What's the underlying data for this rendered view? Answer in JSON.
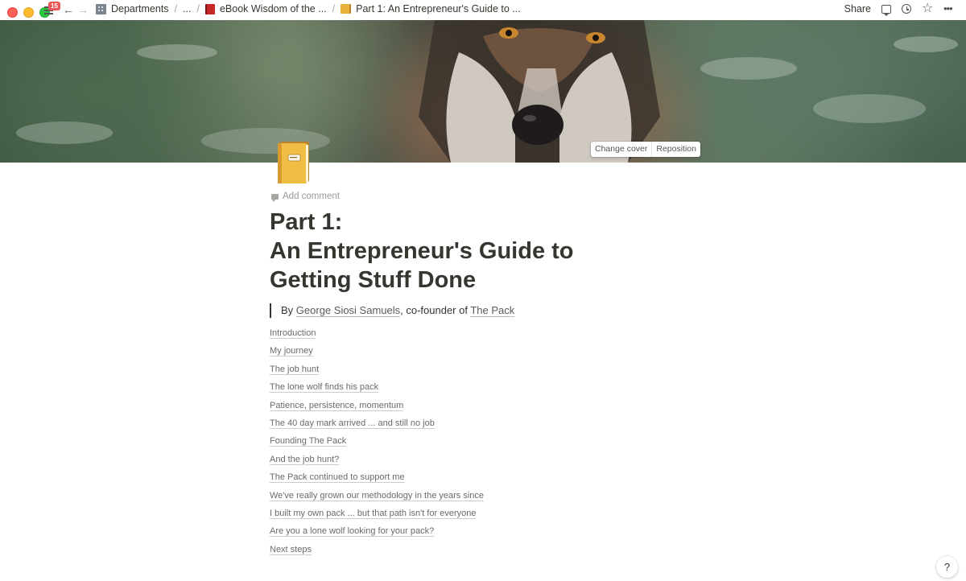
{
  "topbar": {
    "notification_count": "15",
    "breadcrumbs": [
      {
        "label": "Departments",
        "icon": "building-icon"
      },
      {
        "label": "..."
      },
      {
        "label": "eBook Wisdom of the ...",
        "icon": "red-book-icon"
      },
      {
        "label": "Part 1: An Entrepreneur's Guide to ...",
        "icon": "ledger-icon"
      }
    ],
    "share_label": "Share",
    "icons": [
      "comments-icon",
      "updates-icon",
      "favorite-icon",
      "more-icon"
    ]
  },
  "cover": {
    "change_cover_label": "Change cover",
    "reposition_label": "Reposition"
  },
  "page": {
    "add_comment_label": "Add comment",
    "title_line1": "Part 1:",
    "title_line2": "An Entrepreneur's Guide to",
    "title_line3": "Getting Stuff Done",
    "byline_prefix": "By ",
    "author": "George Siosi Samuels",
    "byline_middle": ", co-founder of ",
    "company": "The Pack",
    "toc": [
      "Introduction",
      "My journey",
      "The job hunt",
      "The lone wolf finds his pack",
      "Patience, persistence, momentum",
      "The 40 day mark arrived ... and still no job",
      "Founding The Pack",
      "And the job hunt?",
      "The Pack continued to support me",
      "We've really grown our methodology in the years since",
      "I built my own pack ... but that path isn't for everyone",
      "Are you a lone wolf looking for your pack?",
      "Next steps"
    ]
  },
  "help_label": "?"
}
